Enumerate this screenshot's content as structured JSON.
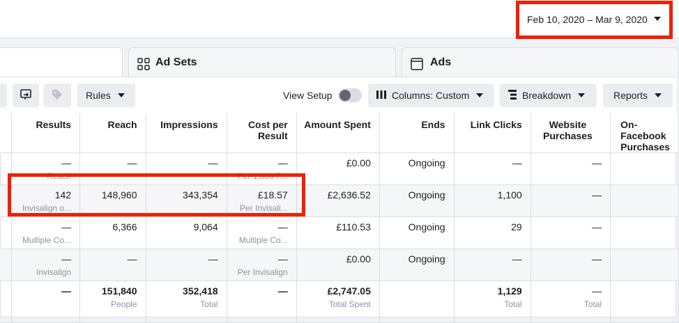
{
  "date_range": "Feb 10, 2020 – Mar 9, 2020",
  "tabs": [
    {
      "label": ""
    },
    {
      "label": "Ad Sets",
      "icon": "ad-sets-icon"
    },
    {
      "label": "Ads",
      "icon": "ads-icon"
    }
  ],
  "toolbar": {
    "rules": "Rules",
    "view_setup": "View Setup",
    "columns": "Columns: Custom",
    "breakdown": "Breakdown",
    "reports": "Reports"
  },
  "columns": [
    "",
    "Results",
    "Reach",
    "Impressions",
    "Cost per Result",
    "Amount Spent",
    "Ends",
    "Link Clicks",
    "Website Purchases",
    "On-Facebook Purchases"
  ],
  "rows": [
    {
      "results": "—",
      "results_sub": "Reach",
      "reach": "—",
      "impressions": "—",
      "cost": "—",
      "cost_sub": "Per 1,000 P...",
      "spent": "£0.00",
      "ends": "Ongoing",
      "clicks": "—",
      "purchases": "—"
    },
    {
      "results": "142",
      "results_sub": "Invisalign o...",
      "reach": "148,960",
      "impressions": "343,354",
      "cost": "£18.57",
      "cost_sub": "Per Invisali...",
      "spent": "£2,636.52",
      "ends": "Ongoing",
      "clicks": "1,100",
      "purchases": "—"
    },
    {
      "results": "—",
      "results_sub": "Multiple Co...",
      "reach": "6,366",
      "impressions": "9,064",
      "cost": "—",
      "cost_sub": "Multiple Co...",
      "spent": "£110.53",
      "ends": "Ongoing",
      "clicks": "29",
      "purchases": "—"
    },
    {
      "results": "—",
      "results_sub": "Invisalign",
      "reach": "—",
      "impressions": "—",
      "cost": "—",
      "cost_sub": "Per Invisalign",
      "spent": "£0.00",
      "ends": "Ongoing",
      "clicks": "—",
      "purchases": "—"
    }
  ],
  "totals": {
    "results": "—",
    "reach": "151,840",
    "reach_sub": "People",
    "impressions": "352,418",
    "impressions_sub": "Total",
    "cost": "—",
    "spent": "£2,747.05",
    "spent_sub": "Total Spent",
    "clicks": "1,129",
    "clicks_sub": "Total",
    "purchases": "—",
    "purchases_sub": "Total"
  },
  "colors": {
    "highlight": "#f02000",
    "header_bg": "#f5f6f7"
  }
}
